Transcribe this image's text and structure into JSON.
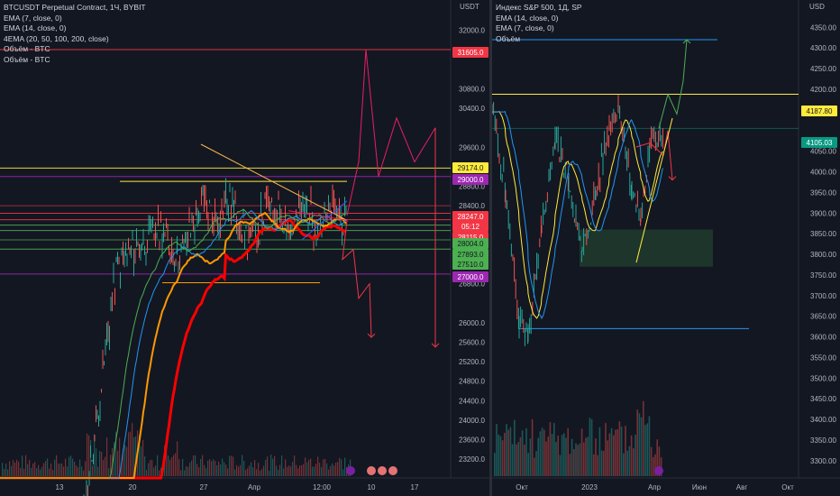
{
  "left_chart": {
    "legend": [
      "BTCUSDT Perpetual Contract, 1Ч, BYBIT",
      "EMA (7, close, 0)",
      "EMA (14, close, 0)",
      "4EMA (20, 50, 100, 200, close)",
      "Объём - BTC",
      "Объём - BTC"
    ],
    "currency": "USDT",
    "y_ticks": [
      "32000.0",
      "30800.0",
      "30400.0",
      "29600.0",
      "28800.0",
      "28400.0",
      "26800.0",
      "26000.0",
      "25600.0",
      "25200.0",
      "24800.0",
      "24400.0",
      "24000.0",
      "23600.0",
      "23200.0"
    ],
    "x_ticks": [
      "13",
      "20",
      "27",
      "Апр",
      "12:00",
      "10",
      "17"
    ],
    "price_labels": [
      {
        "text": "31605.0",
        "bg": "#f23645",
        "fg": "#ffffff"
      },
      {
        "text": "29174.0",
        "bg": "#ffeb3b",
        "fg": "#131722"
      },
      {
        "text": "29000.0",
        "bg": "#9c27b0",
        "fg": "#ffffff"
      },
      {
        "text": "28247.0",
        "bg": "#f23645",
        "fg": "#ffffff"
      },
      {
        "text": "05:12",
        "bg": "#f23645",
        "fg": "#ffffff"
      },
      {
        "text": "28115.0",
        "bg": "#f23645",
        "fg": "#ffffff"
      },
      {
        "text": "28004.0",
        "bg": "#4caf50",
        "fg": "#131722"
      },
      {
        "text": "27893.0",
        "bg": "#4caf50",
        "fg": "#131722"
      },
      {
        "text": "27510.0",
        "bg": "#4caf50",
        "fg": "#131722"
      },
      {
        "text": "27000.0",
        "bg": "#9c27b0",
        "fg": "#ffffff"
      }
    ]
  },
  "right_chart": {
    "legend": [
      "Индекс S&P 500, 1Д, SP",
      "EMA (14, close, 0)",
      "EMA (7, close, 0)",
      "Объём"
    ],
    "currency": "USD",
    "y_ticks": [
      "4350.00",
      "4300.00",
      "4250.00",
      "4200.00",
      "4150.00",
      "4050.00",
      "4000.00",
      "3950.00",
      "3900.00",
      "3850.00",
      "3800.00",
      "3750.00",
      "3700.00",
      "3650.00",
      "3600.00",
      "3550.00",
      "3500.00",
      "3450.00",
      "3400.00",
      "3350.00",
      "3300.00"
    ],
    "x_ticks": [
      "Окт",
      "2023",
      "Апр",
      "Июн",
      "Авг",
      "Окт"
    ],
    "price_labels": [
      {
        "text": "4187.80",
        "bg": "#ffeb3b",
        "fg": "#131722"
      },
      {
        "text": "4105.03",
        "bg": "#089981",
        "fg": "#ffffff"
      }
    ]
  },
  "chart_data": [
    {
      "type": "line",
      "title": "BTCUSDT Perpetual Contract, 1Ч, BYBIT",
      "ylabel": "USDT",
      "ylim": [
        23000,
        32400
      ],
      "x": [
        "13",
        "20",
        "27",
        "Апр",
        "12:00",
        "10",
        "17"
      ],
      "series": [
        {
          "name": "EMA (7, close, 0)",
          "values": [
            19900,
            26500,
            28000,
            27600,
            28200,
            28300,
            28247
          ]
        },
        {
          "name": "EMA (14, close, 0)",
          "values": [
            19800,
            26100,
            27700,
            27500,
            28100,
            28250,
            28200
          ]
        },
        {
          "name": "4EMA (20, 50, 100, 200, close)",
          "values": [
            19500,
            24400,
            27100,
            27300,
            27950,
            28150,
            28115
          ]
        }
      ],
      "levels": [
        31605.0,
        29174.0,
        29000.0,
        28247.0,
        28115.0,
        28004.0,
        27893.0,
        27510.0,
        27000.0
      ]
    },
    {
      "type": "line",
      "title": "Индекс S&P 500, 1Д, SP",
      "ylabel": "USD",
      "ylim": [
        3280,
        4390
      ],
      "x": [
        "Окт",
        "2023",
        "Апр",
        "Июн",
        "Авг",
        "Окт"
      ],
      "series": [
        {
          "name": "EMA (14, close, 0)",
          "values": [
            3700,
            3880,
            4060,
            4105
          ]
        },
        {
          "name": "EMA (7, close, 0)",
          "values": [
            3640,
            3900,
            4080,
            4105
          ]
        }
      ],
      "levels": [
        4187.8,
        4105.03
      ]
    }
  ]
}
